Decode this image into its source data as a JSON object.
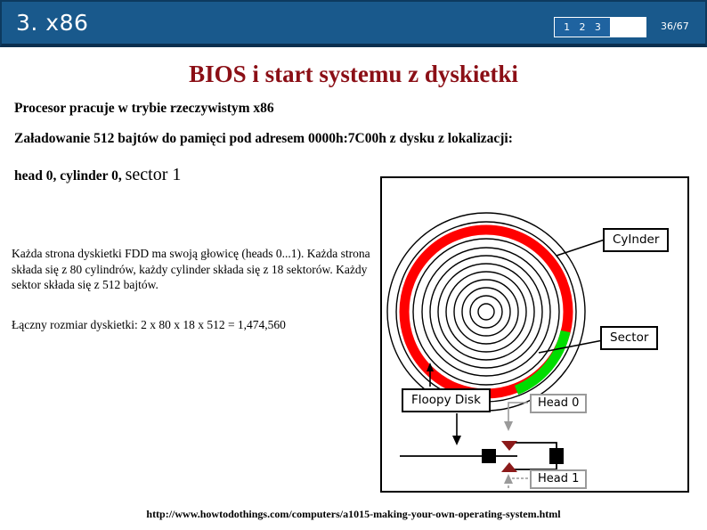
{
  "header": {
    "section_title": "3. x86",
    "nav_steps": [
      "1",
      "2",
      "3"
    ],
    "slide_counter": "36/67",
    "bar_color": "#19598c",
    "nav_fill_color": "#1f63a0"
  },
  "slide": {
    "title": "BIOS i start systemu z dyskietki",
    "title_color": "#8b0f16",
    "line_realmode": "Procesor pracuje w trybie rzeczywistym x86",
    "line_load": "Załadowanie 512 bajtów do pamięci pod adresem 0000h:7C00h z dysku z lokalizacji:",
    "chs_prefix": "head 0, cylinder 0, ",
    "chs_emphasis": "sector 1",
    "para_description": "Każda strona dyskietki FDD ma swoją głowicę (heads 0...1). Każda strona składa się z 80 cylindrów, każdy cylinder składa się z 18 sektorów. Każdy sektor składa się z 512 bajtów.",
    "para_total": "Łączny rozmiar dyskietki:  2 x 80 x 18 x 512 = 1,474,560"
  },
  "diagram": {
    "labels": {
      "cylinder": "CyInder",
      "sector": "Sector",
      "floppy_disk": "Floopy Disk",
      "head0": "Head 0",
      "head1": "Head 1"
    },
    "colors": {
      "track_highlight": "#ff0000",
      "sector_highlight": "#00dd00",
      "outline": "#000000",
      "callout_gray": "#9a9a9a",
      "head_marker": "#8b1a1a"
    },
    "ring_count": 11
  },
  "footer": {
    "url": "http://www.howtodothings.com/computers/a1015-making-your-own-operating-system.html"
  }
}
